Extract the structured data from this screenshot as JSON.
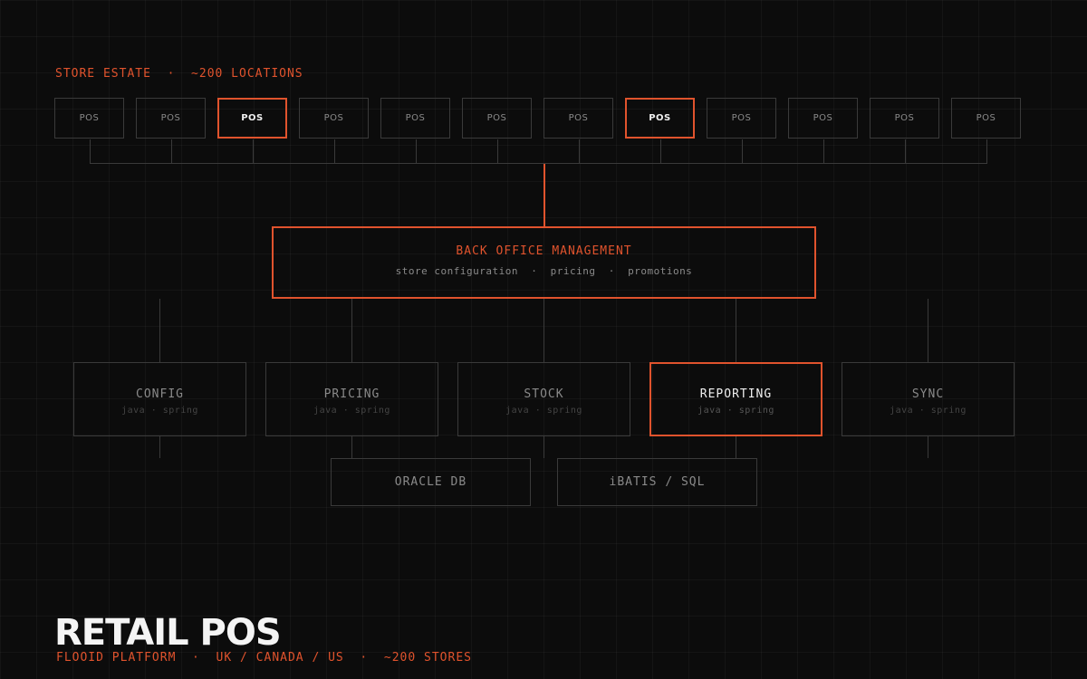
{
  "store_estate": {
    "label": "STORE ESTATE  ·  ~200 LOCATIONS",
    "pos_terminals": [
      {
        "label": "POS",
        "highlighted": false
      },
      {
        "label": "POS",
        "highlighted": false
      },
      {
        "label": "POS",
        "highlighted": true
      },
      {
        "label": "POS",
        "highlighted": false
      },
      {
        "label": "POS",
        "highlighted": false
      },
      {
        "label": "POS",
        "highlighted": false
      },
      {
        "label": "POS",
        "highlighted": false
      },
      {
        "label": "POS",
        "highlighted": true
      },
      {
        "label": "POS",
        "highlighted": false
      },
      {
        "label": "POS",
        "highlighted": false
      },
      {
        "label": "POS",
        "highlighted": false
      },
      {
        "label": "POS",
        "highlighted": false
      }
    ]
  },
  "back_office": {
    "title": "BACK OFFICE MANAGEMENT",
    "subtitle": "store configuration  ·  pricing  ·  promotions"
  },
  "services": [
    {
      "name": "CONFIG",
      "tech": "java · spring",
      "highlighted": false
    },
    {
      "name": "PRICING",
      "tech": "java · spring",
      "highlighted": false
    },
    {
      "name": "STOCK",
      "tech": "java · spring",
      "highlighted": false
    },
    {
      "name": "REPORTING",
      "tech": "java · spring",
      "highlighted": true
    },
    {
      "name": "SYNC",
      "tech": "java · spring",
      "highlighted": false
    }
  ],
  "data_layer": [
    {
      "name": "ORACLE DB"
    },
    {
      "name": "iBATIS / SQL"
    }
  ],
  "footer": {
    "title": "RETAIL POS",
    "subtitle": "FLOOID PLATFORM  ·  UK / CANADA / US  ·  ~200 STORES"
  },
  "colors": {
    "background": "#0c0c0c",
    "accent": "#e0532d",
    "border": "#3a3a3a",
    "muted_text": "#8a8a8a",
    "bright_text": "#f0f0f0"
  }
}
